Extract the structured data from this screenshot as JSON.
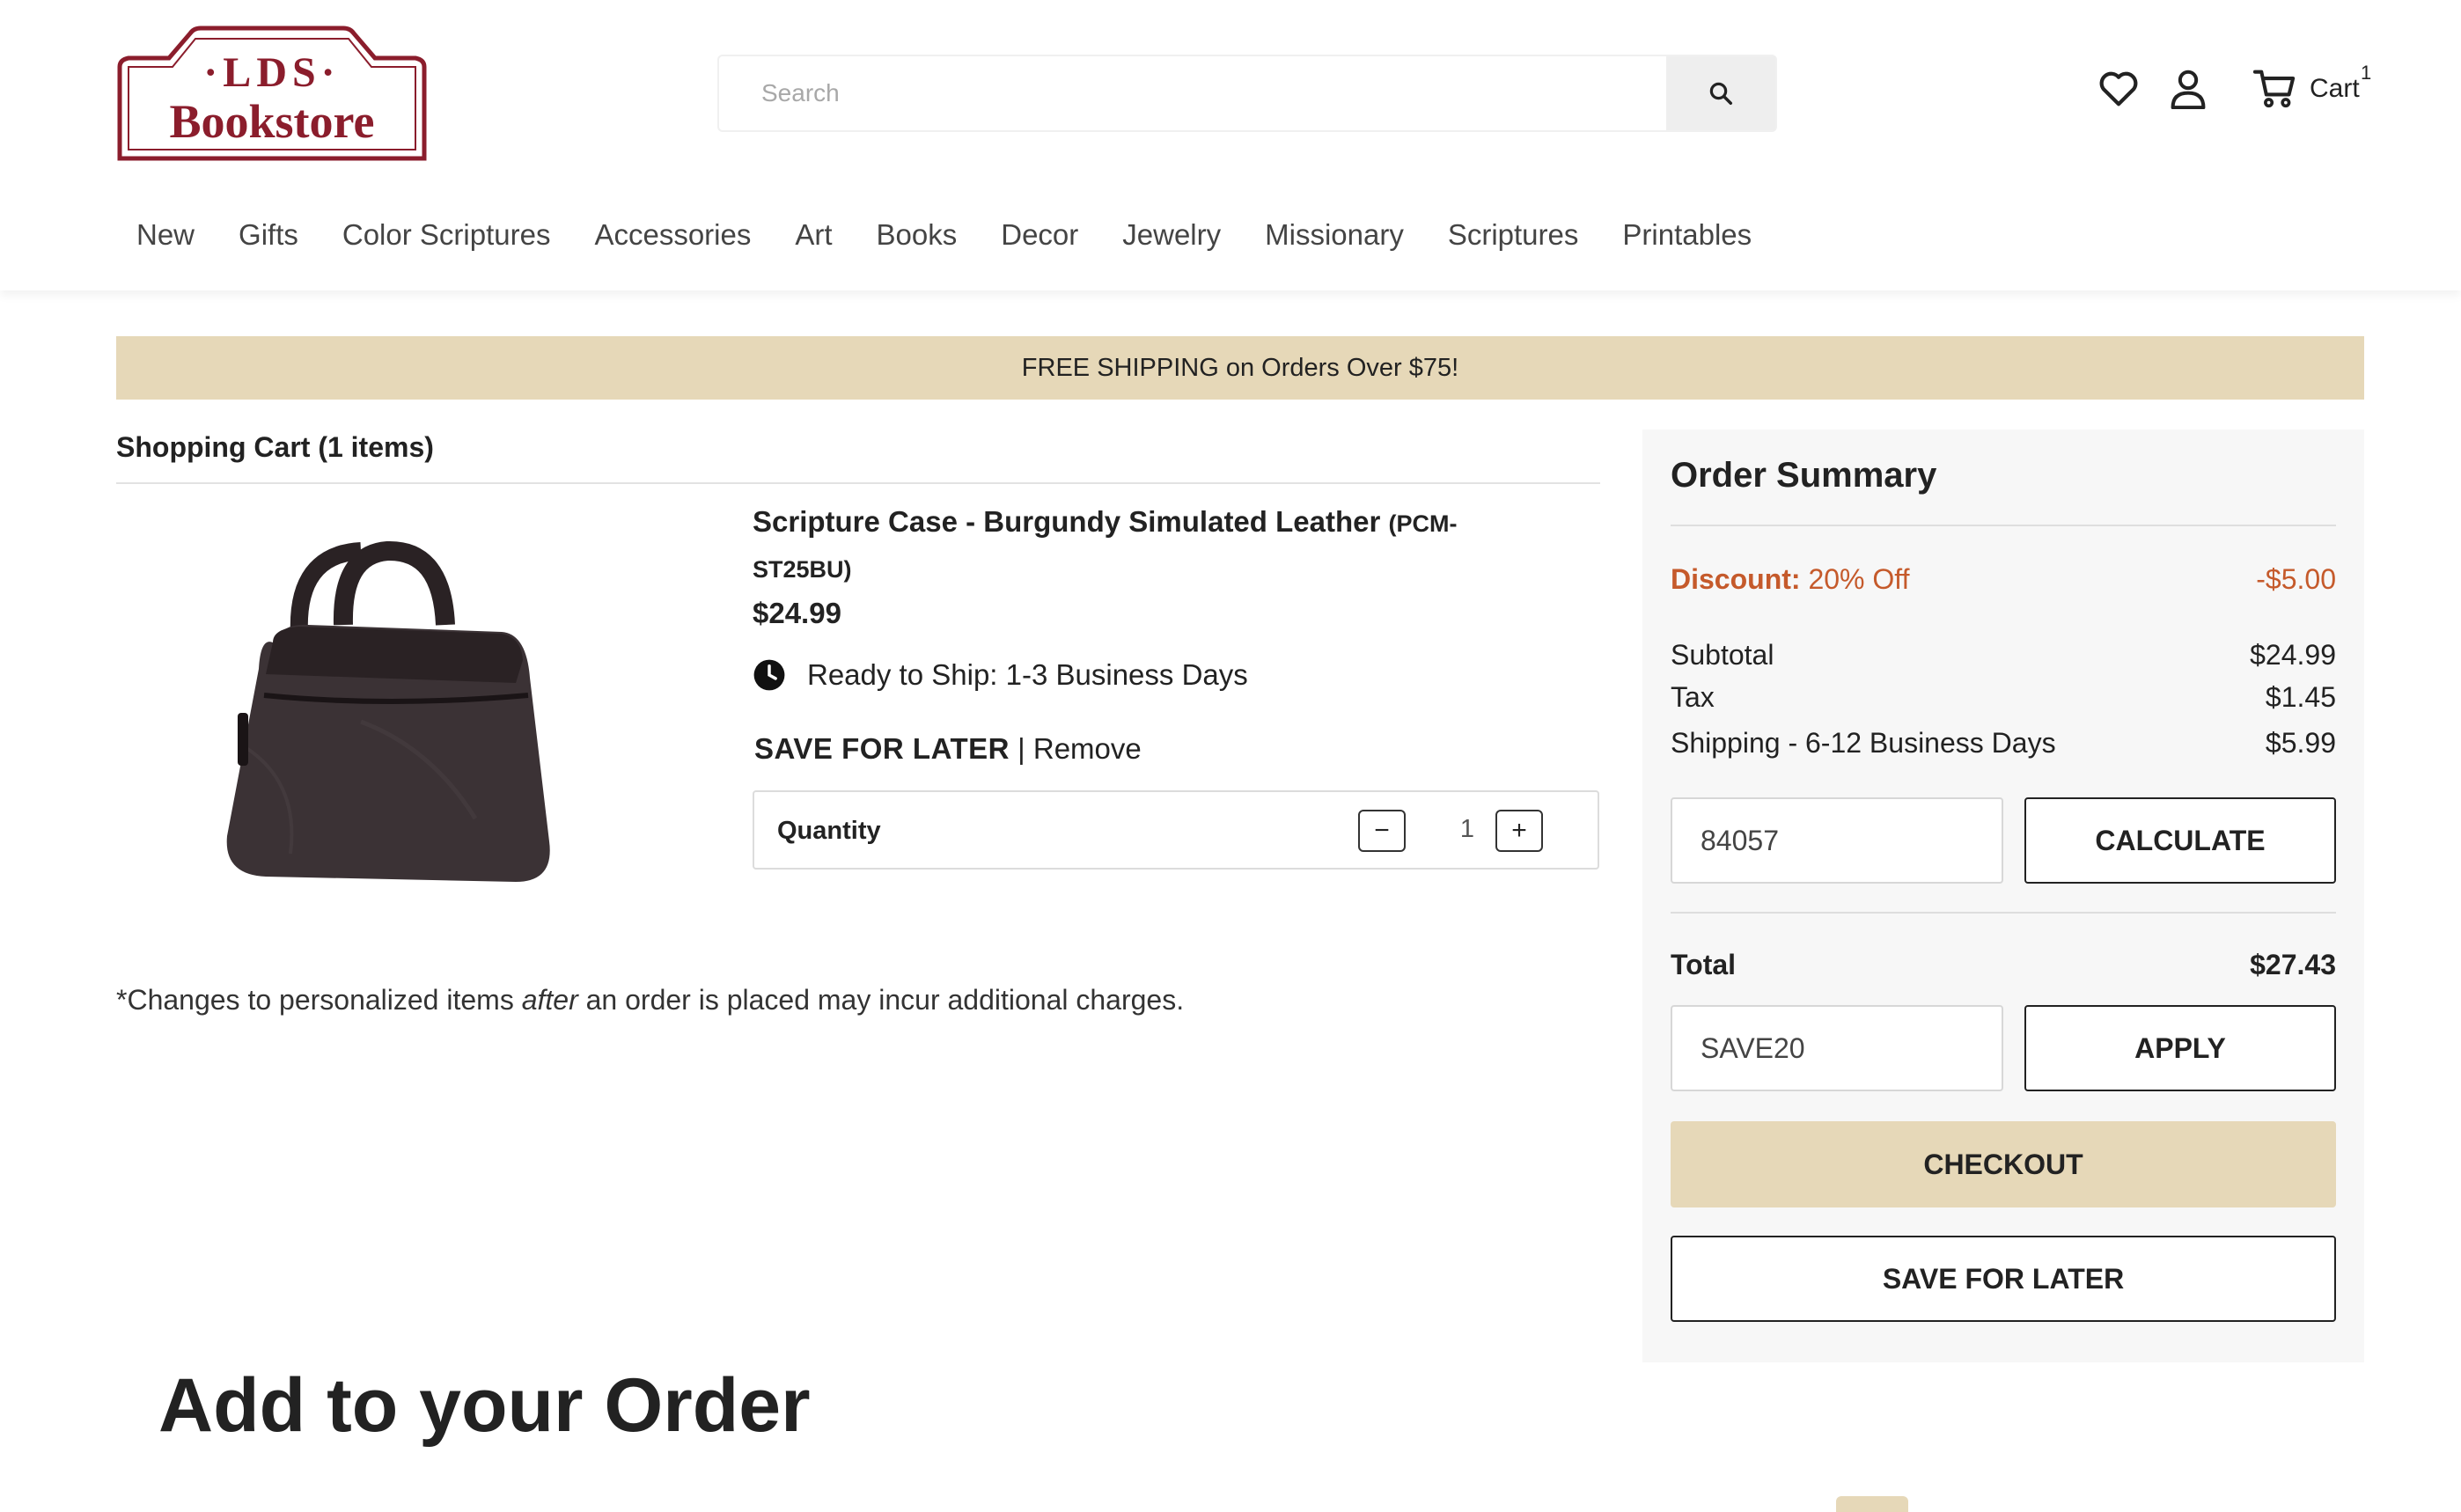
{
  "header": {
    "logo_top": "·LDS·",
    "logo_bottom": "Bookstore",
    "search_placeholder": "Search",
    "cart_label": "Cart",
    "cart_count": "1"
  },
  "nav": [
    "New",
    "Gifts",
    "Color Scriptures",
    "Accessories",
    "Art",
    "Books",
    "Decor",
    "Jewelry",
    "Missionary",
    "Scriptures",
    "Printables"
  ],
  "banner": "FREE SHIPPING on Orders Over $75!",
  "cart": {
    "title": "Shopping Cart (1 items)",
    "item": {
      "name": "Scripture Case - Burgundy Simulated Leather",
      "sku": "(PCM-ST25BU)",
      "price": "$24.99",
      "shipping": "Ready to Ship: 1-3 Business Days",
      "save_for_later": "SAVE FOR LATER",
      "separator": "|",
      "remove": "Remove",
      "quantity_label": "Quantity",
      "quantity": "1",
      "minus": "−",
      "plus": "+"
    },
    "note_before": "*Changes to personalized items ",
    "note_italic": "after",
    "note_after": " an order is placed may incur additional charges."
  },
  "summary": {
    "title": "Order Summary",
    "discount_label": "Discount:",
    "discount_desc": "20% Off",
    "discount_value": "-$5.00",
    "subtotal_label": "Subtotal",
    "subtotal_value": "$24.99",
    "tax_label": "Tax",
    "tax_value": "$1.45",
    "shipping_label": "Shipping - 6-12 Business Days",
    "shipping_value": "$5.99",
    "zip_value": "84057",
    "calculate_label": "CALCULATE",
    "total_label": "Total",
    "total_value": "$27.43",
    "promo_value": "SAVE20",
    "apply_label": "APPLY",
    "checkout_label": "CHECKOUT",
    "save_for_later_label": "SAVE FOR LATER"
  },
  "add_to_order_title": "Add to your Order",
  "colors": {
    "brand_red": "#8b1d2c",
    "banner_tan": "#e6d8b8",
    "discount_orange": "#c55a2b"
  }
}
